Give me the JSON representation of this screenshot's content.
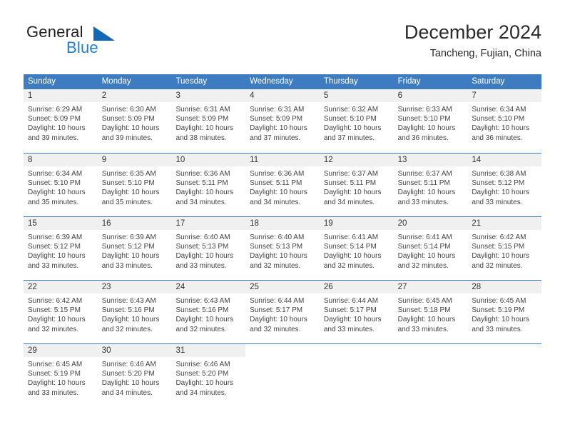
{
  "brand": {
    "name_part1": "General",
    "name_part2": "Blue",
    "triangle_color": "#1268b3",
    "blue_color": "#1f7fd4"
  },
  "header": {
    "title": "December 2024",
    "location": "Tancheng, Fujian, China"
  },
  "theme": {
    "header_blue": "#3d7cc0",
    "day_band_gray": "#f0f0f0"
  },
  "weekdays": [
    "Sunday",
    "Monday",
    "Tuesday",
    "Wednesday",
    "Thursday",
    "Friday",
    "Saturday"
  ],
  "weeks": [
    [
      {
        "day": "1",
        "sunrise": "Sunrise: 6:29 AM",
        "sunset": "Sunset: 5:09 PM",
        "daylight1": "Daylight: 10 hours",
        "daylight2": "and 39 minutes."
      },
      {
        "day": "2",
        "sunrise": "Sunrise: 6:30 AM",
        "sunset": "Sunset: 5:09 PM",
        "daylight1": "Daylight: 10 hours",
        "daylight2": "and 39 minutes."
      },
      {
        "day": "3",
        "sunrise": "Sunrise: 6:31 AM",
        "sunset": "Sunset: 5:09 PM",
        "daylight1": "Daylight: 10 hours",
        "daylight2": "and 38 minutes."
      },
      {
        "day": "4",
        "sunrise": "Sunrise: 6:31 AM",
        "sunset": "Sunset: 5:09 PM",
        "daylight1": "Daylight: 10 hours",
        "daylight2": "and 37 minutes."
      },
      {
        "day": "5",
        "sunrise": "Sunrise: 6:32 AM",
        "sunset": "Sunset: 5:10 PM",
        "daylight1": "Daylight: 10 hours",
        "daylight2": "and 37 minutes."
      },
      {
        "day": "6",
        "sunrise": "Sunrise: 6:33 AM",
        "sunset": "Sunset: 5:10 PM",
        "daylight1": "Daylight: 10 hours",
        "daylight2": "and 36 minutes."
      },
      {
        "day": "7",
        "sunrise": "Sunrise: 6:34 AM",
        "sunset": "Sunset: 5:10 PM",
        "daylight1": "Daylight: 10 hours",
        "daylight2": "and 36 minutes."
      }
    ],
    [
      {
        "day": "8",
        "sunrise": "Sunrise: 6:34 AM",
        "sunset": "Sunset: 5:10 PM",
        "daylight1": "Daylight: 10 hours",
        "daylight2": "and 35 minutes."
      },
      {
        "day": "9",
        "sunrise": "Sunrise: 6:35 AM",
        "sunset": "Sunset: 5:10 PM",
        "daylight1": "Daylight: 10 hours",
        "daylight2": "and 35 minutes."
      },
      {
        "day": "10",
        "sunrise": "Sunrise: 6:36 AM",
        "sunset": "Sunset: 5:11 PM",
        "daylight1": "Daylight: 10 hours",
        "daylight2": "and 34 minutes."
      },
      {
        "day": "11",
        "sunrise": "Sunrise: 6:36 AM",
        "sunset": "Sunset: 5:11 PM",
        "daylight1": "Daylight: 10 hours",
        "daylight2": "and 34 minutes."
      },
      {
        "day": "12",
        "sunrise": "Sunrise: 6:37 AM",
        "sunset": "Sunset: 5:11 PM",
        "daylight1": "Daylight: 10 hours",
        "daylight2": "and 34 minutes."
      },
      {
        "day": "13",
        "sunrise": "Sunrise: 6:37 AM",
        "sunset": "Sunset: 5:11 PM",
        "daylight1": "Daylight: 10 hours",
        "daylight2": "and 33 minutes."
      },
      {
        "day": "14",
        "sunrise": "Sunrise: 6:38 AM",
        "sunset": "Sunset: 5:12 PM",
        "daylight1": "Daylight: 10 hours",
        "daylight2": "and 33 minutes."
      }
    ],
    [
      {
        "day": "15",
        "sunrise": "Sunrise: 6:39 AM",
        "sunset": "Sunset: 5:12 PM",
        "daylight1": "Daylight: 10 hours",
        "daylight2": "and 33 minutes."
      },
      {
        "day": "16",
        "sunrise": "Sunrise: 6:39 AM",
        "sunset": "Sunset: 5:12 PM",
        "daylight1": "Daylight: 10 hours",
        "daylight2": "and 33 minutes."
      },
      {
        "day": "17",
        "sunrise": "Sunrise: 6:40 AM",
        "sunset": "Sunset: 5:13 PM",
        "daylight1": "Daylight: 10 hours",
        "daylight2": "and 33 minutes."
      },
      {
        "day": "18",
        "sunrise": "Sunrise: 6:40 AM",
        "sunset": "Sunset: 5:13 PM",
        "daylight1": "Daylight: 10 hours",
        "daylight2": "and 32 minutes."
      },
      {
        "day": "19",
        "sunrise": "Sunrise: 6:41 AM",
        "sunset": "Sunset: 5:14 PM",
        "daylight1": "Daylight: 10 hours",
        "daylight2": "and 32 minutes."
      },
      {
        "day": "20",
        "sunrise": "Sunrise: 6:41 AM",
        "sunset": "Sunset: 5:14 PM",
        "daylight1": "Daylight: 10 hours",
        "daylight2": "and 32 minutes."
      },
      {
        "day": "21",
        "sunrise": "Sunrise: 6:42 AM",
        "sunset": "Sunset: 5:15 PM",
        "daylight1": "Daylight: 10 hours",
        "daylight2": "and 32 minutes."
      }
    ],
    [
      {
        "day": "22",
        "sunrise": "Sunrise: 6:42 AM",
        "sunset": "Sunset: 5:15 PM",
        "daylight1": "Daylight: 10 hours",
        "daylight2": "and 32 minutes."
      },
      {
        "day": "23",
        "sunrise": "Sunrise: 6:43 AM",
        "sunset": "Sunset: 5:16 PM",
        "daylight1": "Daylight: 10 hours",
        "daylight2": "and 32 minutes."
      },
      {
        "day": "24",
        "sunrise": "Sunrise: 6:43 AM",
        "sunset": "Sunset: 5:16 PM",
        "daylight1": "Daylight: 10 hours",
        "daylight2": "and 32 minutes."
      },
      {
        "day": "25",
        "sunrise": "Sunrise: 6:44 AM",
        "sunset": "Sunset: 5:17 PM",
        "daylight1": "Daylight: 10 hours",
        "daylight2": "and 32 minutes."
      },
      {
        "day": "26",
        "sunrise": "Sunrise: 6:44 AM",
        "sunset": "Sunset: 5:17 PM",
        "daylight1": "Daylight: 10 hours",
        "daylight2": "and 33 minutes."
      },
      {
        "day": "27",
        "sunrise": "Sunrise: 6:45 AM",
        "sunset": "Sunset: 5:18 PM",
        "daylight1": "Daylight: 10 hours",
        "daylight2": "and 33 minutes."
      },
      {
        "day": "28",
        "sunrise": "Sunrise: 6:45 AM",
        "sunset": "Sunset: 5:19 PM",
        "daylight1": "Daylight: 10 hours",
        "daylight2": "and 33 minutes."
      }
    ],
    [
      {
        "day": "29",
        "sunrise": "Sunrise: 6:45 AM",
        "sunset": "Sunset: 5:19 PM",
        "daylight1": "Daylight: 10 hours",
        "daylight2": "and 33 minutes."
      },
      {
        "day": "30",
        "sunrise": "Sunrise: 6:46 AM",
        "sunset": "Sunset: 5:20 PM",
        "daylight1": "Daylight: 10 hours",
        "daylight2": "and 34 minutes."
      },
      {
        "day": "31",
        "sunrise": "Sunrise: 6:46 AM",
        "sunset": "Sunset: 5:20 PM",
        "daylight1": "Daylight: 10 hours",
        "daylight2": "and 34 minutes."
      },
      {
        "day": "",
        "sunrise": "",
        "sunset": "",
        "daylight1": "",
        "daylight2": ""
      },
      {
        "day": "",
        "sunrise": "",
        "sunset": "",
        "daylight1": "",
        "daylight2": ""
      },
      {
        "day": "",
        "sunrise": "",
        "sunset": "",
        "daylight1": "",
        "daylight2": ""
      },
      {
        "day": "",
        "sunrise": "",
        "sunset": "",
        "daylight1": "",
        "daylight2": ""
      }
    ]
  ]
}
